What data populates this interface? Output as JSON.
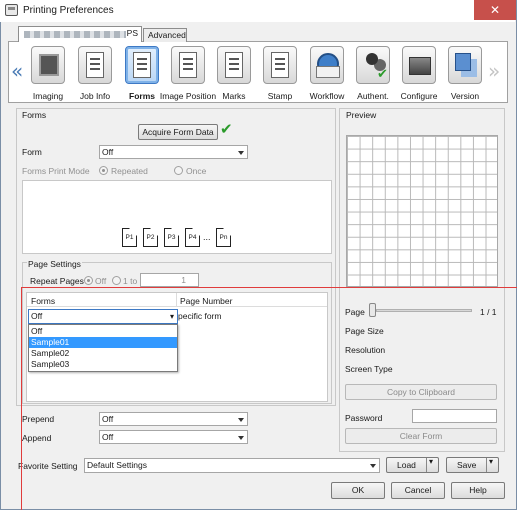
{
  "window": {
    "title": "Printing Preferences",
    "close_glyph": "✕"
  },
  "tabs": [
    {
      "label": "PS",
      "selected": true
    },
    {
      "label": "Advanced",
      "selected": false
    }
  ],
  "toolbar": {
    "items": [
      {
        "label": "Imaging",
        "icon": "imaging-icon"
      },
      {
        "label": "Job Info",
        "icon": "job-info-icon"
      },
      {
        "label": "Forms",
        "icon": "forms-icon",
        "selected": true
      },
      {
        "label": "Image Position",
        "icon": "image-position-icon"
      },
      {
        "label": "Marks",
        "icon": "marks-icon"
      },
      {
        "label": "Stamp",
        "icon": "stamp-icon"
      },
      {
        "label": "Workflow",
        "icon": "workflow-icon"
      },
      {
        "label": "Authent.",
        "icon": "authentication-icon"
      },
      {
        "label": "Configure",
        "icon": "configure-icon"
      },
      {
        "label": "Version",
        "icon": "version-icon"
      }
    ],
    "prev_glyph": "«",
    "next_glyph": "»"
  },
  "forms": {
    "group_title": "Forms",
    "acquire_button": "Acquire Form Data",
    "acquire_status_glyph": "✔",
    "form_label": "Form",
    "form_value": "Off",
    "print_mode_label": "Forms Print Mode",
    "mode_repeated": "Repeated",
    "mode_once": "Once",
    "pages": [
      "P1",
      "P2",
      "P3",
      "P4",
      "...",
      "Pn"
    ]
  },
  "page_settings": {
    "group_title": "Page Settings",
    "repeat_pages_label": "Repeat Pages",
    "off_label": "Off",
    "range_from": "1 to",
    "range_to_value": "1",
    "col_forms": "Forms",
    "col_page_number": "Page Number",
    "row_page_number": "pecific form",
    "selected_form": "Off",
    "dropdown_options": [
      "Off",
      "Sample01",
      "Sample02",
      "Sample03"
    ],
    "highlighted_option": "Sample01"
  },
  "prepend": {
    "label": "Prepend",
    "value": "Off"
  },
  "append": {
    "label": "Append",
    "value": "Off"
  },
  "preview": {
    "group_title": "Preview",
    "page_label": "Page",
    "page_count": "1 / 1",
    "page_size_label": "Page Size",
    "resolution_label": "Resolution",
    "screen_type_label": "Screen Type",
    "copy_button": "Copy to Clipboard",
    "password_label": "Password",
    "password_value": "",
    "clear_button": "Clear Form"
  },
  "favorite": {
    "label": "Favorite Setting",
    "value": "Default Settings",
    "load_button": "Load",
    "save_button": "Save"
  },
  "footer": {
    "ok": "OK",
    "cancel": "Cancel",
    "help": "Help"
  },
  "colors": {
    "accent": "#3399ff",
    "annotation_red": "#e03c3c",
    "check_green": "#2b9b2b"
  }
}
